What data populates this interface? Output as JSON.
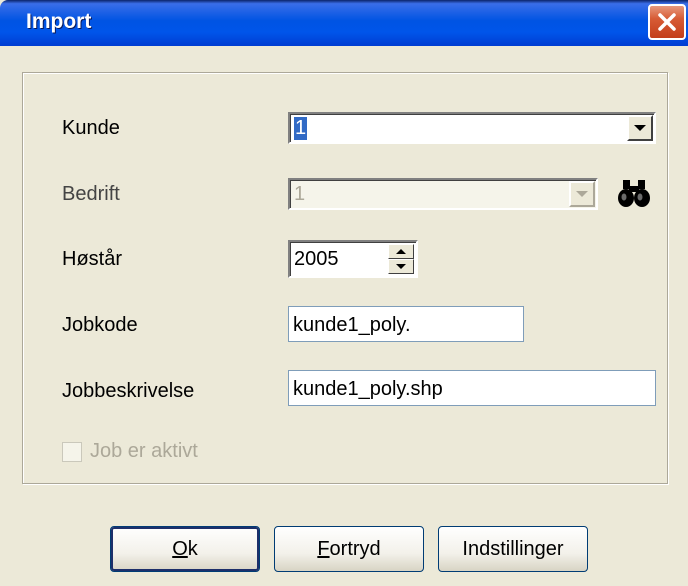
{
  "window": {
    "title": "Import"
  },
  "form": {
    "kunde": {
      "label": "Kunde",
      "value": "1"
    },
    "bedrift": {
      "label": "Bedrift",
      "value": "1"
    },
    "hoestaar": {
      "label": "Høstår",
      "value": "2005"
    },
    "jobkode": {
      "label": "Jobkode",
      "value": "kunde1_poly."
    },
    "jobbeskrivelse": {
      "label": "Jobbeskrivelse",
      "value": "kunde1_poly.shp"
    },
    "job_aktiv": {
      "label": "Job er aktivt",
      "checked": false
    }
  },
  "buttons": {
    "ok": {
      "mnemonic": "O",
      "rest": "k"
    },
    "fortryd": {
      "mnemonic": "F",
      "rest": "ortryd"
    },
    "indstillinger": {
      "label": "Indstillinger"
    }
  },
  "icons": {
    "close": "close-icon",
    "finder": "binoculars-icon"
  }
}
